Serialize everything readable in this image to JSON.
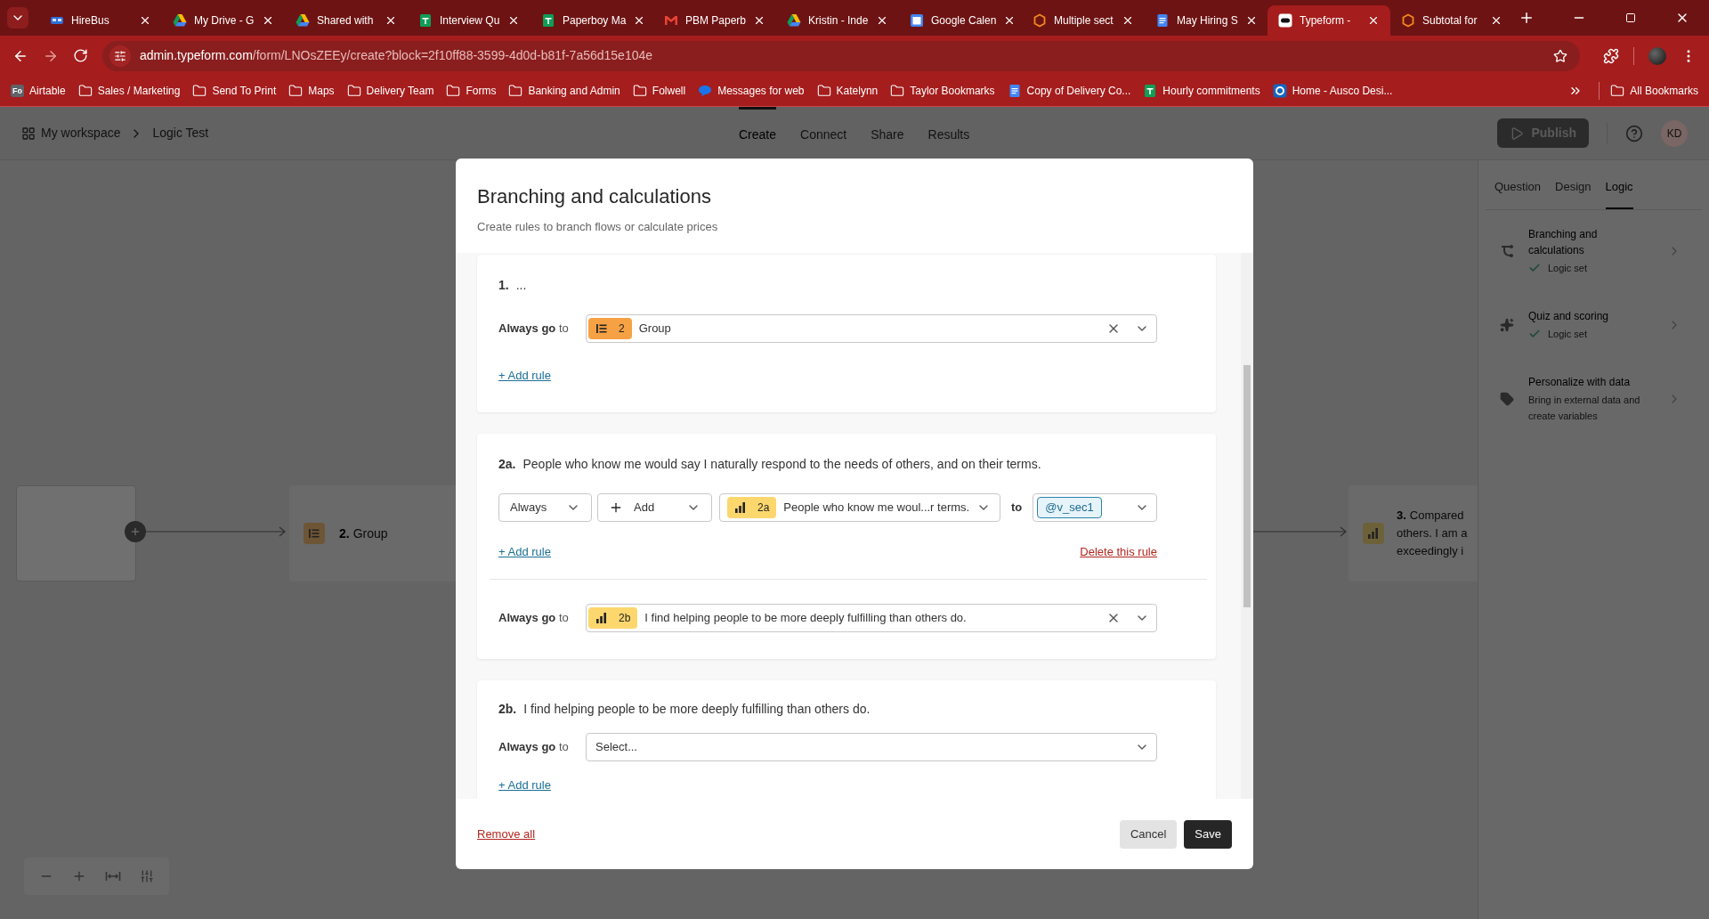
{
  "browser": {
    "tabs": [
      {
        "title": "HireBus",
        "kind": "hirebus",
        "selected": false
      },
      {
        "title": "My Drive - G",
        "kind": "drive",
        "selected": false
      },
      {
        "title": "Shared with",
        "kind": "drive",
        "selected": false
      },
      {
        "title": "Interview Qu",
        "kind": "sheets",
        "selected": false
      },
      {
        "title": "Paperboy Ma",
        "kind": "sheets",
        "selected": false
      },
      {
        "title": "PBM Paperb",
        "kind": "gmail",
        "selected": false
      },
      {
        "title": "Kristin - Inde",
        "kind": "drive",
        "selected": false
      },
      {
        "title": "Google Calen",
        "kind": "calendar",
        "selected": false
      },
      {
        "title": "Multiple sect",
        "kind": "help",
        "selected": false
      },
      {
        "title": "May Hiring S",
        "kind": "docs",
        "selected": false
      },
      {
        "title": "Typeform -",
        "kind": "typeform",
        "selected": true
      },
      {
        "title": "Subtotal for",
        "kind": "help",
        "selected": false
      }
    ],
    "address": {
      "host": "admin.typeform.com",
      "path": "/form/LNOsZEEy/create?block=2f10ff88-3599-4d0d-b81f-7a56d15e104e"
    },
    "bookmarks": [
      {
        "label": "Airtable",
        "kind": "badge",
        "badge": "Fo"
      },
      {
        "label": "Sales / Marketing",
        "kind": "folder"
      },
      {
        "label": "Send To Print",
        "kind": "folder"
      },
      {
        "label": "Maps",
        "kind": "folder"
      },
      {
        "label": "Delivery Team",
        "kind": "folder"
      },
      {
        "label": "Forms",
        "kind": "folder"
      },
      {
        "label": "Banking and Admin",
        "kind": "folder"
      },
      {
        "label": "Folwell",
        "kind": "folder"
      },
      {
        "label": "Messages for web",
        "kind": "messages"
      },
      {
        "label": "Katelynn",
        "kind": "folder"
      },
      {
        "label": "Taylor Bookmarks",
        "kind": "folder"
      },
      {
        "label": "Copy of Delivery Co...",
        "kind": "docs"
      },
      {
        "label": "Hourly commitments",
        "kind": "sheets"
      },
      {
        "label": "Home - Ausco Desi...",
        "kind": "edge"
      }
    ],
    "all_bookmarks": "All Bookmarks"
  },
  "app": {
    "breadcrumb": [
      "My workspace",
      "Logic Test"
    ],
    "nav": [
      {
        "label": "Create",
        "selected": true
      },
      {
        "label": "Connect",
        "selected": false
      },
      {
        "label": "Share",
        "selected": false
      },
      {
        "label": "Results",
        "selected": false
      }
    ],
    "publish": "Publish",
    "avatar": "KD"
  },
  "canvas": {
    "nodes": [
      {
        "number": "2.",
        "lines": [
          "Group"
        ],
        "kind": "group"
      },
      {
        "number": "3.",
        "lines": [
          "Compared",
          "others. I am a",
          "exceedingly i"
        ],
        "kind": "opinion"
      }
    ]
  },
  "panel": {
    "tabs": [
      {
        "label": "Question",
        "selected": false
      },
      {
        "label": "Design",
        "selected": false
      },
      {
        "label": "Logic",
        "selected": true
      }
    ],
    "items": [
      {
        "kind": "branch",
        "title": "Branching and calculations",
        "status": "Logic set",
        "checked": true
      },
      {
        "kind": "sparkle",
        "title": "Quiz and scoring",
        "status": "Logic set",
        "checked": true
      },
      {
        "kind": "tag",
        "title": "Personalize with data",
        "status": "Bring in external data and create variables",
        "checked": false
      }
    ]
  },
  "modal": {
    "title": "Branching and calculations",
    "subtitle": "Create rules to branch flows or calculate prices",
    "blocks": [
      {
        "number": "1.",
        "text": "...",
        "goto": {
          "label": "**Always go** to",
          "target": {
            "kind": "group",
            "badge": "2",
            "text": "Group"
          }
        },
        "add_rule": "+ Add rule"
      },
      {
        "number": "2a.",
        "text": "People who know me would say I naturally respond to the needs of others, and on their terms.",
        "rules": [
          {
            "condition": "Always",
            "action": "Add",
            "question": {
              "kind": "opinion",
              "badge": "2a",
              "text": "People who know me woul...r terms."
            },
            "to": "to",
            "variable": "@v_sec1",
            "add_rule": "+ Add rule",
            "delete": "Delete this rule"
          }
        ],
        "goto": {
          "label": "**Always go** to",
          "target": {
            "kind": "opinion",
            "badge": "2b",
            "text": "I find helping people to be more deeply fulfilling than others do."
          }
        }
      },
      {
        "number": "2b.",
        "text": "I find helping people to be more deeply fulfilling than others do.",
        "goto": {
          "label": "**Always go** to",
          "placeholder": "Select..."
        },
        "add_rule": "+ Add rule"
      }
    ],
    "remove_all": "Remove all",
    "cancel": "Cancel",
    "save": "Save"
  }
}
